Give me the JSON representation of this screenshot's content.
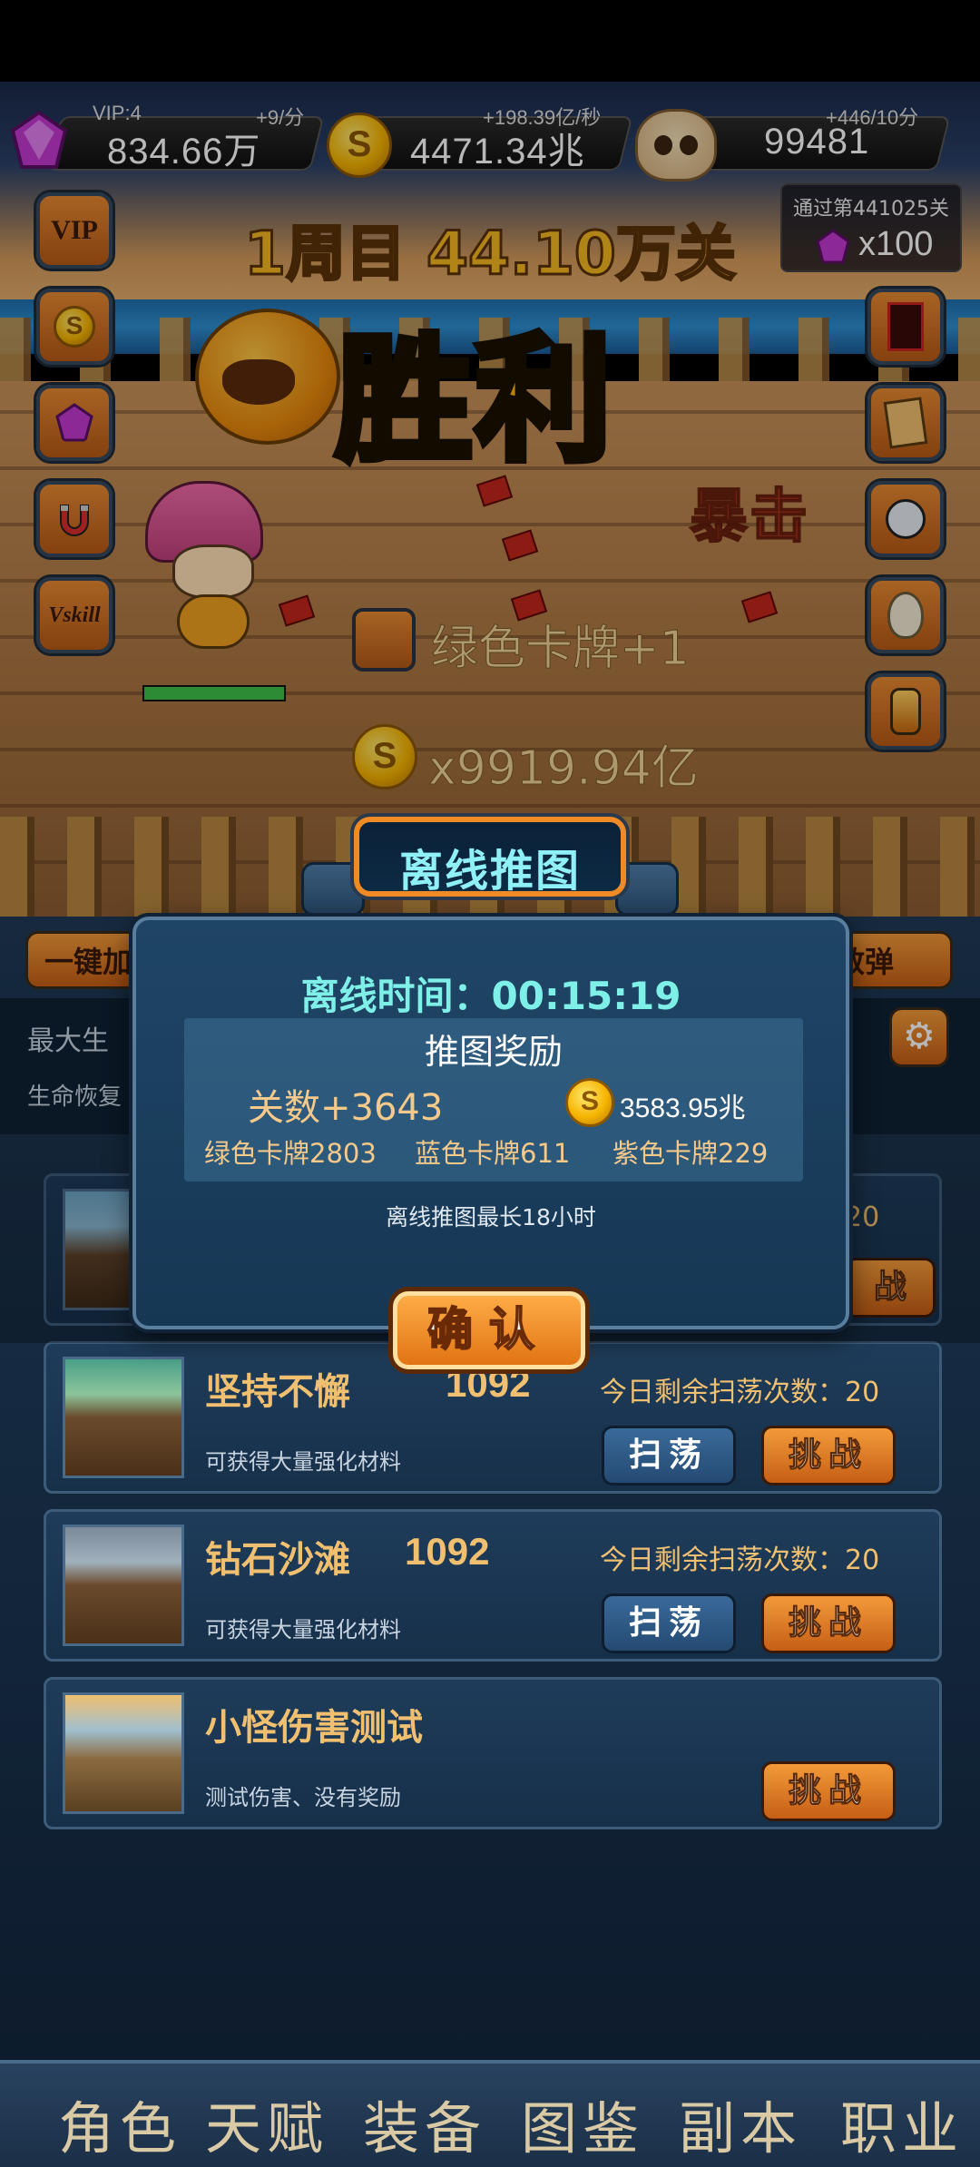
{
  "currencies": {
    "gems": {
      "vip": "VIP:4",
      "rate": "+9/分",
      "value": "834.66万",
      "icon": "purple-gem-icon"
    },
    "gold": {
      "rate": "+198.39亿/秒",
      "value": "4471.34兆",
      "icon": "gold-coin-icon"
    },
    "skull": {
      "rate": "+446/10分",
      "value": "99481",
      "icon": "skull-icon"
    }
  },
  "pass_reward": {
    "title": "通过第441025关",
    "count": "x100"
  },
  "stage": {
    "title": "1周目 44.10万关",
    "victory": "胜利",
    "crit_text": "暴击"
  },
  "left_buttons": [
    {
      "label": "VIP",
      "icon": "vip-icon"
    },
    {
      "label": "",
      "icon": "coin-icon"
    },
    {
      "label": "",
      "icon": "gem-icon"
    },
    {
      "label": "",
      "icon": "magnet-icon"
    },
    {
      "label": "Vskill",
      "icon": "vskill-icon"
    }
  ],
  "right_buttons": [
    {
      "icon": "card-back-icon"
    },
    {
      "icon": "card-deck-icon"
    },
    {
      "icon": "robot-icon"
    },
    {
      "icon": "egg-icon"
    },
    {
      "icon": "lantern-icon"
    }
  ],
  "battle": {
    "card_gain": "绿色卡牌+1",
    "gold_gain": "x9919.94亿",
    "hp_fraction": 1.0
  },
  "mid": {
    "left_button": "一键加",
    "right_button": "散弹",
    "max_life_label": "最大生",
    "life_regen_label": "生命恢复"
  },
  "modal": {
    "tab_title": "离线推图",
    "offline_time": "离线时间：00:15:19",
    "reward_title": "推图奖励",
    "levels": "关数+3643",
    "gold": "3583.95兆",
    "cards": [
      "绿色卡牌2803",
      "蓝色卡牌611",
      "紫色卡牌229"
    ],
    "note": "离线推图最长18小时",
    "confirm": "确认"
  },
  "dungeons": [
    {
      "name": "",
      "level": "",
      "desc": "",
      "remain": "20",
      "sweep": "",
      "challenge": "战"
    },
    {
      "name": "坚持不懈",
      "level": "1092",
      "desc": "可获得大量强化材料",
      "remain": "今日剩余扫荡次数：20",
      "sweep": "扫荡",
      "challenge": "挑战"
    },
    {
      "name": "钻石沙滩",
      "level": "1092",
      "desc": "可获得大量强化材料",
      "remain": "今日剩余扫荡次数：20",
      "sweep": "扫荡",
      "challenge": "挑战"
    },
    {
      "name": "小怪伤害测试",
      "level": "",
      "desc": "测试伤害、没有奖励",
      "remain": "",
      "sweep": "",
      "challenge": "挑战"
    }
  ],
  "nav": [
    "角色",
    "天赋",
    "装备",
    "图鉴",
    "副本",
    "职业"
  ],
  "colors": {
    "accent_orange": "#f08a24",
    "title_gold": "#f5b820",
    "modal_cyan": "#7ef0e8"
  }
}
